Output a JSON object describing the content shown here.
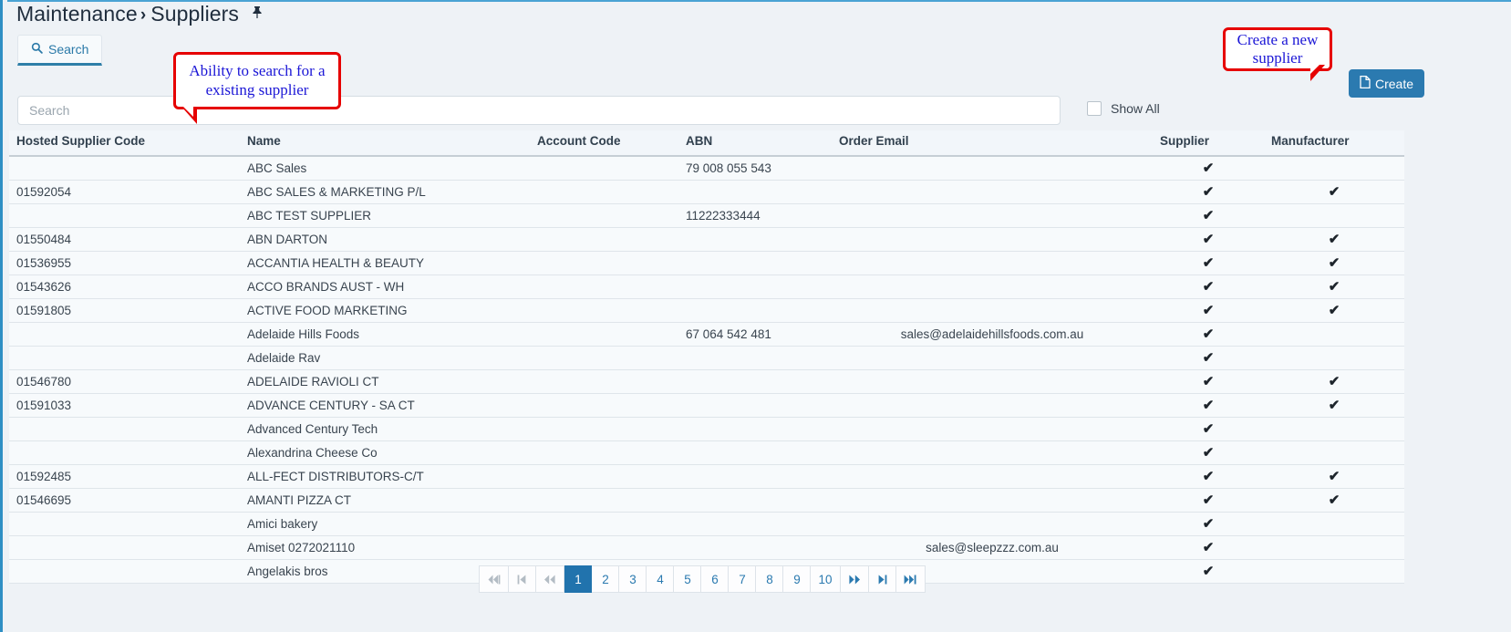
{
  "breadcrumb": {
    "root": "Maintenance",
    "separator": "›",
    "current": "Suppliers",
    "pin_icon": "📌"
  },
  "tabs": [
    {
      "label": "Search",
      "icon": "search-icon",
      "icon_glyph": "🔍",
      "active": true
    }
  ],
  "search": {
    "placeholder": "Search",
    "value": ""
  },
  "show_all": {
    "label": "Show All",
    "checked": false
  },
  "create_button": {
    "label": "Create",
    "icon": "document-icon",
    "icon_glyph": "🗋",
    "color": "#2b7ab0"
  },
  "callouts": [
    {
      "id": "callout-search",
      "text": "Ability to search for a existing supplier",
      "border_color": "#e60000",
      "text_color": "#1b16d6"
    },
    {
      "id": "callout-create",
      "text": "Create a new supplier",
      "border_color": "#e60000",
      "text_color": "#1b16d6"
    }
  ],
  "table": {
    "columns": [
      "Hosted Supplier Code",
      "Name",
      "Account Code",
      "ABN",
      "Order Email",
      "Supplier",
      "Manufacturer"
    ],
    "tick_glyph": "✔",
    "rows": [
      {
        "hosted_supplier_code": "",
        "name": "ABC Sales",
        "account_code": "",
        "abn": "79 008 055 543",
        "order_email": "",
        "supplier": true,
        "manufacturer": false
      },
      {
        "hosted_supplier_code": "01592054",
        "name": "ABC SALES & MARKETING P/L",
        "account_code": "",
        "abn": "",
        "order_email": "",
        "supplier": true,
        "manufacturer": true
      },
      {
        "hosted_supplier_code": "",
        "name": "ABC TEST SUPPLIER",
        "account_code": "",
        "abn": "11222333444",
        "order_email": "",
        "supplier": true,
        "manufacturer": false
      },
      {
        "hosted_supplier_code": "01550484",
        "name": "ABN DARTON",
        "account_code": "",
        "abn": "",
        "order_email": "",
        "supplier": true,
        "manufacturer": true
      },
      {
        "hosted_supplier_code": "01536955",
        "name": "ACCANTIA HEALTH & BEAUTY",
        "account_code": "",
        "abn": "",
        "order_email": "",
        "supplier": true,
        "manufacturer": true
      },
      {
        "hosted_supplier_code": "01543626",
        "name": "ACCO BRANDS AUST - WH",
        "account_code": "",
        "abn": "",
        "order_email": "",
        "supplier": true,
        "manufacturer": true
      },
      {
        "hosted_supplier_code": "01591805",
        "name": "ACTIVE FOOD MARKETING",
        "account_code": "",
        "abn": "",
        "order_email": "",
        "supplier": true,
        "manufacturer": true
      },
      {
        "hosted_supplier_code": "",
        "name": "Adelaide Hills Foods",
        "account_code": "",
        "abn": "67 064 542 481",
        "order_email": "sales@adelaidehillsfoods.com.au",
        "supplier": true,
        "manufacturer": false
      },
      {
        "hosted_supplier_code": "",
        "name": "Adelaide Rav",
        "account_code": "",
        "abn": "",
        "order_email": "",
        "supplier": true,
        "manufacturer": false
      },
      {
        "hosted_supplier_code": "01546780",
        "name": "ADELAIDE RAVIOLI CT",
        "account_code": "",
        "abn": "",
        "order_email": "",
        "supplier": true,
        "manufacturer": true
      },
      {
        "hosted_supplier_code": "01591033",
        "name": "ADVANCE CENTURY - SA CT",
        "account_code": "",
        "abn": "",
        "order_email": "",
        "supplier": true,
        "manufacturer": true
      },
      {
        "hosted_supplier_code": "",
        "name": "Advanced Century Tech",
        "account_code": "",
        "abn": "",
        "order_email": "",
        "supplier": true,
        "manufacturer": false
      },
      {
        "hosted_supplier_code": "",
        "name": "Alexandrina Cheese Co",
        "account_code": "",
        "abn": "",
        "order_email": "",
        "supplier": true,
        "manufacturer": false
      },
      {
        "hosted_supplier_code": "01592485",
        "name": "ALL-FECT DISTRIBUTORS-C/T",
        "account_code": "",
        "abn": "",
        "order_email": "",
        "supplier": true,
        "manufacturer": true
      },
      {
        "hosted_supplier_code": "01546695",
        "name": "AMANTI PIZZA CT",
        "account_code": "",
        "abn": "",
        "order_email": "",
        "supplier": true,
        "manufacturer": true
      },
      {
        "hosted_supplier_code": "",
        "name": "Amici bakery",
        "account_code": "",
        "abn": "",
        "order_email": "",
        "supplier": true,
        "manufacturer": false
      },
      {
        "hosted_supplier_code": "",
        "name": "Amiset 0272021110",
        "account_code": "",
        "abn": "",
        "order_email": "sales@sleepzzz.com.au",
        "supplier": true,
        "manufacturer": false
      },
      {
        "hosted_supplier_code": "",
        "name": "Angelakis bros",
        "account_code": "",
        "abn": "",
        "order_email": "",
        "supplier": true,
        "manufacturer": false
      }
    ]
  },
  "pagination": {
    "current_page": "1",
    "buttons": [
      {
        "id": "first-page",
        "label": "◀◀|",
        "glyph": "⏮",
        "kind": "nav",
        "dim": true
      },
      {
        "id": "prev-block",
        "label": "|◀",
        "glyph": "⏪",
        "kind": "nav",
        "dim": true
      },
      {
        "id": "prev-page",
        "label": "◀◀",
        "glyph": "«",
        "kind": "nav",
        "dim": true
      },
      {
        "id": "page-1",
        "label": "1",
        "kind": "page",
        "active": true
      },
      {
        "id": "page-2",
        "label": "2",
        "kind": "page",
        "active": false
      },
      {
        "id": "page-3",
        "label": "3",
        "kind": "page",
        "active": false
      },
      {
        "id": "page-4",
        "label": "4",
        "kind": "page",
        "active": false
      },
      {
        "id": "page-5",
        "label": "5",
        "kind": "page",
        "active": false
      },
      {
        "id": "page-6",
        "label": "6",
        "kind": "page",
        "active": false
      },
      {
        "id": "page-7",
        "label": "7",
        "kind": "page",
        "active": false
      },
      {
        "id": "page-8",
        "label": "8",
        "kind": "page",
        "active": false
      },
      {
        "id": "page-9",
        "label": "9",
        "kind": "page",
        "active": false
      },
      {
        "id": "page-10",
        "label": "10",
        "kind": "page",
        "active": false
      },
      {
        "id": "next-page",
        "label": "▶▶",
        "kind": "nav",
        "dim": false
      },
      {
        "id": "next-block",
        "label": "▶|",
        "kind": "nav",
        "dim": false
      },
      {
        "id": "last-page",
        "label": "▶▶|",
        "kind": "nav",
        "dim": false
      }
    ]
  }
}
